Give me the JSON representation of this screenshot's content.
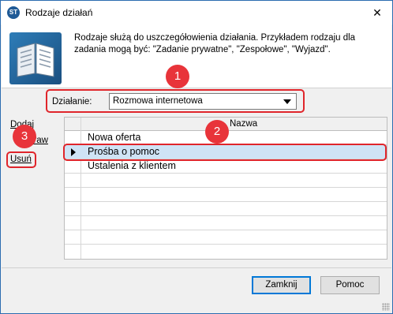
{
  "window": {
    "title": "Rodzaje działań",
    "app_icon_text": "ST",
    "close_symbol": "✕"
  },
  "header": {
    "description": "Rodzaje służą do uszczegółowienia działania. Przykładem rodzaju dla zadania mogą być: \"Zadanie prywatne\", \"Zespołowe\", \"Wyjazd\".",
    "icon": "book-icon"
  },
  "filter": {
    "label": "Działanie:",
    "selected_value": "Rozmowa internetowa"
  },
  "actions": {
    "add": "Dodaj",
    "edit": "Popraw",
    "delete": "Usuń"
  },
  "grid": {
    "column_header": "Nazwa",
    "rows": [
      {
        "name": "Nowa oferta",
        "selected": false
      },
      {
        "name": "Prośba o pomoc",
        "selected": true
      },
      {
        "name": "Ustalenia z klientem",
        "selected": false
      }
    ]
  },
  "callouts": [
    "1",
    "2",
    "3"
  ],
  "buttons": {
    "close": "Zamknij",
    "help": "Pomoc"
  },
  "colors": {
    "callout": "#e8343a",
    "selection": "#cfe3f5",
    "window_border": "#2b6cb0"
  }
}
